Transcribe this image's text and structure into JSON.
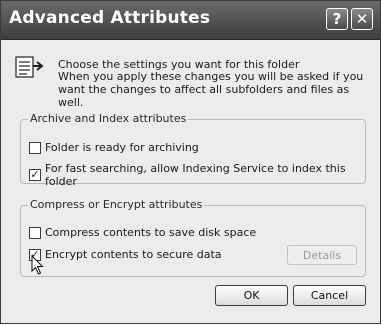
{
  "window": {
    "title": "Advanced Attributes",
    "help_glyph": "?",
    "close_glyph": "✕"
  },
  "intro": {
    "icon": "folder-settings-icon",
    "line1": "Choose the settings you want for this folder",
    "line2": "When you apply these changes you will be asked if you want the changes to affect all subfolders and files as well."
  },
  "archive_group": {
    "label": "Archive and Index attributes",
    "options": [
      {
        "label": "Folder is ready for archiving",
        "checked": false
      },
      {
        "label": "For fast searching, allow Indexing Service to index this folder",
        "checked": true
      }
    ]
  },
  "compress_group": {
    "label": "Compress or Encrypt attributes",
    "options": [
      {
        "label": "Compress contents to save disk space",
        "checked": false
      },
      {
        "label": "Encrypt contents to secure data",
        "checked": true
      }
    ],
    "details_label": "Details"
  },
  "buttons": {
    "ok": "OK",
    "cancel": "Cancel"
  },
  "cursor": "mouse-pointer-icon",
  "colors": {
    "titlebar": "#4e4e4e",
    "dialog_bg": "#ececec",
    "disabled_text": "#9a9a9a"
  }
}
